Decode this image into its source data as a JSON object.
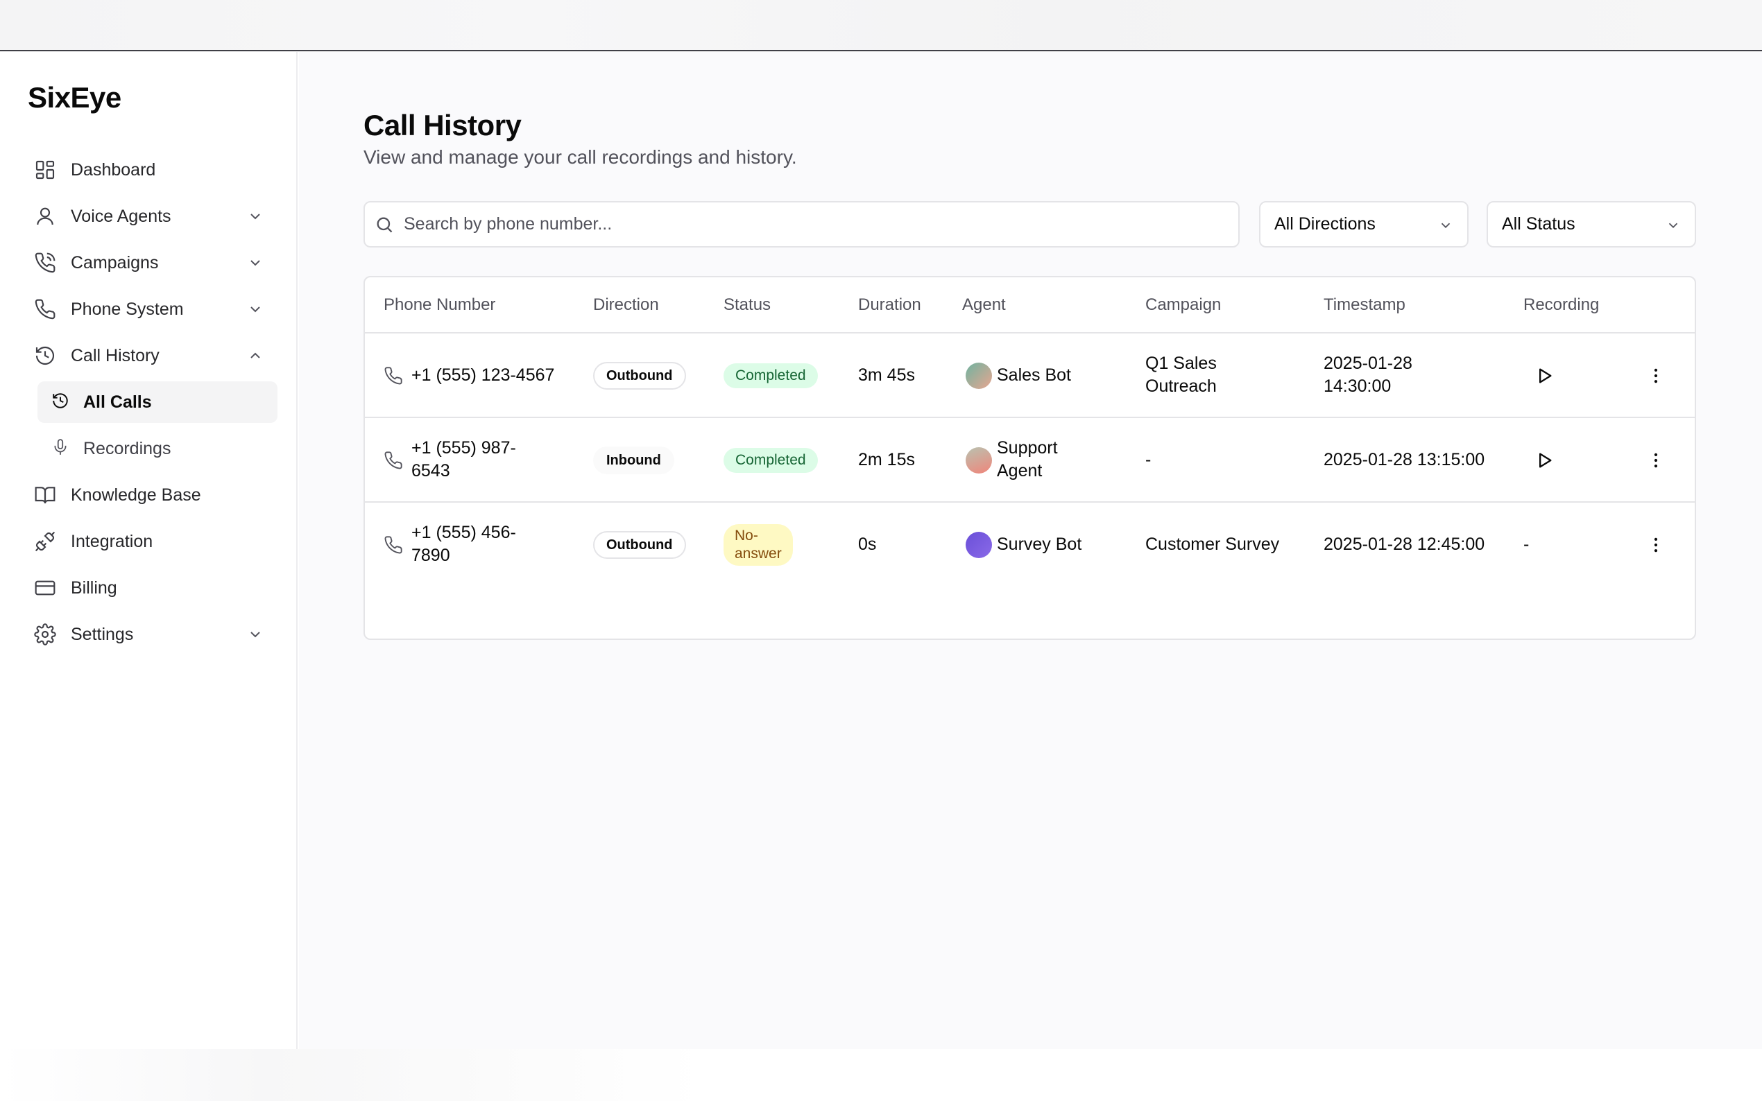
{
  "app": {
    "brand": "SixEye"
  },
  "sidebar": {
    "items": [
      {
        "label": "Dashboard",
        "icon": "dashboard-icon",
        "has_chevron": false
      },
      {
        "label": "Voice Agents",
        "icon": "user-icon",
        "has_chevron": true
      },
      {
        "label": "Campaigns",
        "icon": "phone-outgoing-icon",
        "has_chevron": true
      },
      {
        "label": "Phone System",
        "icon": "phone-icon",
        "has_chevron": true
      },
      {
        "label": "Call History",
        "icon": "history-icon",
        "has_chevron": true,
        "expanded": true
      },
      {
        "label": "Knowledge Base",
        "icon": "book-open-icon",
        "has_chevron": false
      },
      {
        "label": "Integration",
        "icon": "plug-icon",
        "has_chevron": false
      },
      {
        "label": "Billing",
        "icon": "credit-card-icon",
        "has_chevron": false
      },
      {
        "label": "Settings",
        "icon": "gear-icon",
        "has_chevron": true
      }
    ],
    "sub_items": [
      {
        "label": "All Calls",
        "icon": "history-icon",
        "active": true
      },
      {
        "label": "Recordings",
        "icon": "microphone-icon",
        "active": false
      }
    ]
  },
  "page": {
    "title": "Call History",
    "subtitle": "View and manage your call recordings and history."
  },
  "filters": {
    "search_placeholder": "Search by phone number...",
    "direction": "All Directions",
    "status": "All Status"
  },
  "table": {
    "columns": [
      "Phone Number",
      "Direction",
      "Status",
      "Duration",
      "Agent",
      "Campaign",
      "Timestamp",
      "Recording"
    ],
    "rows": [
      {
        "phone": [
          "+1 (555) 123-4567"
        ],
        "direction": "Outbound",
        "status": [
          "Completed"
        ],
        "status_type": "completed",
        "duration": "3m 45s",
        "agent": [
          "Sales Bot"
        ],
        "agent_color": "#7fb8a4",
        "campaign": [
          "Q1 Sales",
          "Outreach"
        ],
        "timestamp": [
          "2025-01-28",
          "14:30:00"
        ],
        "recording": "play"
      },
      {
        "phone": [
          "+1 (555) 987-",
          "6543"
        ],
        "direction": "Inbound",
        "status": [
          "Completed"
        ],
        "status_type": "completed",
        "duration": "2m 15s",
        "agent": [
          "Support",
          "Agent"
        ],
        "agent_color": "#e89a8f",
        "campaign": [
          "-"
        ],
        "timestamp": [
          "2025-01-28 13:15:00"
        ],
        "recording": "play"
      },
      {
        "phone": [
          "+1 (555) 456-",
          "7890"
        ],
        "direction": "Outbound",
        "status": [
          "No-",
          "answer"
        ],
        "status_type": "no-answer",
        "duration": "0s",
        "agent": [
          "Survey Bot"
        ],
        "agent_color": "#7c5ce0",
        "campaign": [
          "Customer Survey"
        ],
        "timestamp": [
          "2025-01-28 12:45:00"
        ],
        "recording": "-"
      }
    ]
  }
}
